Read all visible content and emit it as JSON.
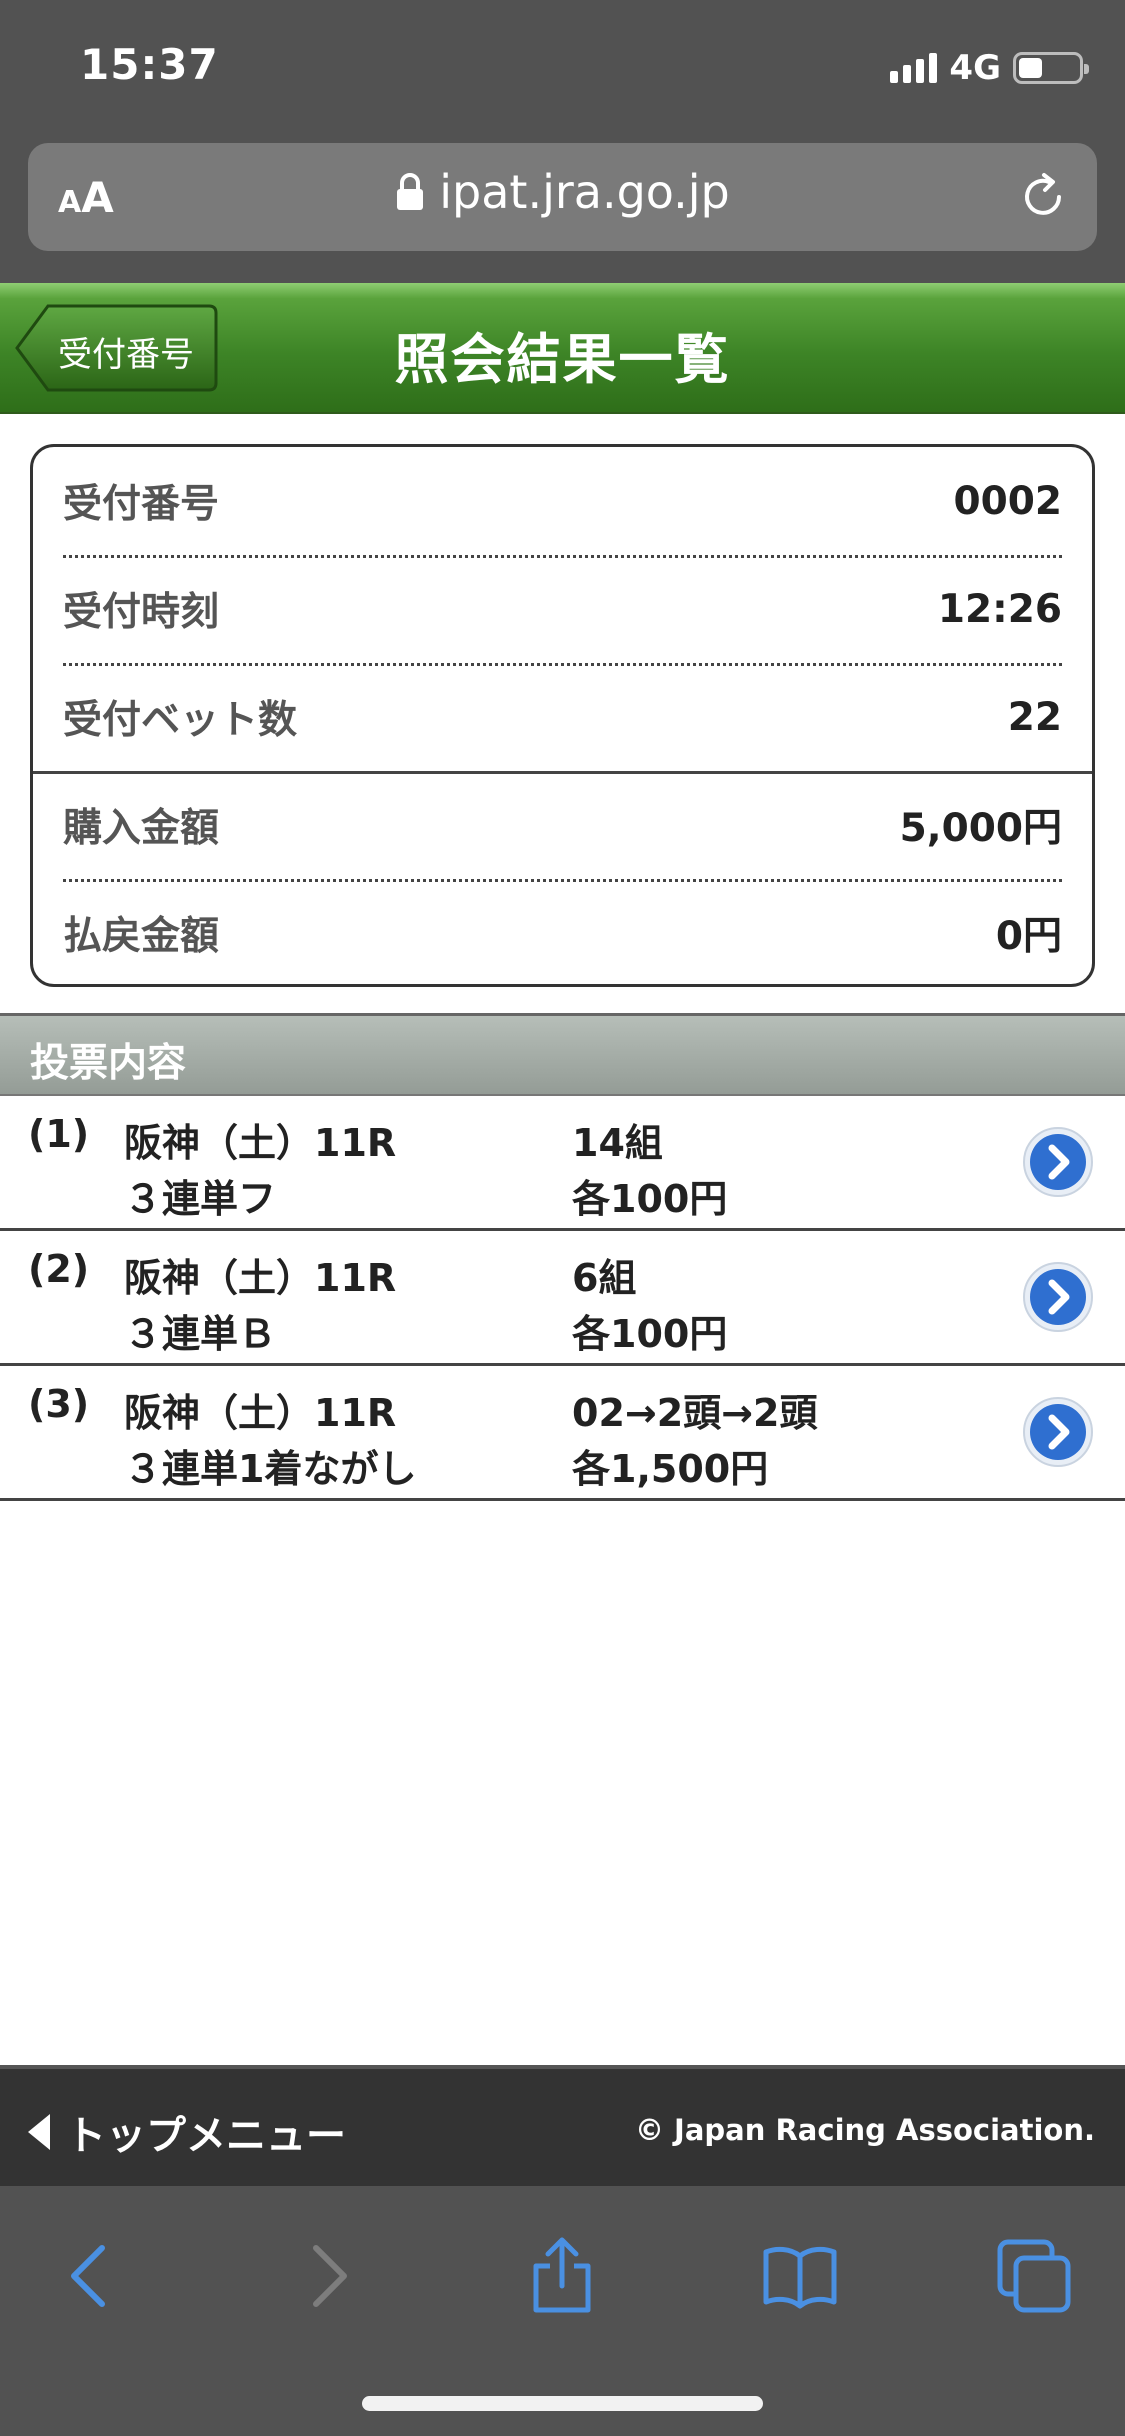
{
  "status_bar": {
    "time": "15:37",
    "network": "4G"
  },
  "browser": {
    "aa_small": "A",
    "aa_big": "A",
    "url": "ipat.jra.go.jp"
  },
  "header": {
    "back_label": "受付番号",
    "title": "照会結果一覧"
  },
  "summary": [
    {
      "label": "受付番号",
      "value": "0002"
    },
    {
      "label": "受付時刻",
      "value": "12:26"
    },
    {
      "label": "受付ベット数",
      "value": "22"
    },
    {
      "label": "購入金額",
      "value": "5,000円"
    },
    {
      "label": "払戻金額",
      "value": "0円"
    }
  ],
  "section": {
    "title": "投票内容"
  },
  "bets": [
    {
      "num": "(1)",
      "race": "阪神（土）11R",
      "type": "３連単フ",
      "combo": "14組",
      "amount": "各100円"
    },
    {
      "num": "(2)",
      "race": "阪神（土）11R",
      "type": "３連単Ｂ",
      "combo": "6組",
      "amount": "各100円"
    },
    {
      "num": "(3)",
      "race": "阪神（土）11R",
      "type": "３連単1着ながし",
      "combo": "02→2頭→2頭",
      "amount": "各1,500円"
    }
  ],
  "footer": {
    "top_menu_label": "トップメニュー",
    "copyright": "© Japan Racing Association."
  },
  "colors": {
    "header_green": "#3d8426",
    "toolbar_icon_blue": "#4a90e2",
    "chrome_gray": "#525252"
  },
  "icons": {
    "lock": "lock-icon",
    "reload": "reload-icon",
    "detail": "chevron-right-circle-icon",
    "back": "back-icon",
    "forward": "forward-icon",
    "share": "share-icon",
    "bookmarks": "bookmarks-icon",
    "tabs": "tabs-icon"
  }
}
